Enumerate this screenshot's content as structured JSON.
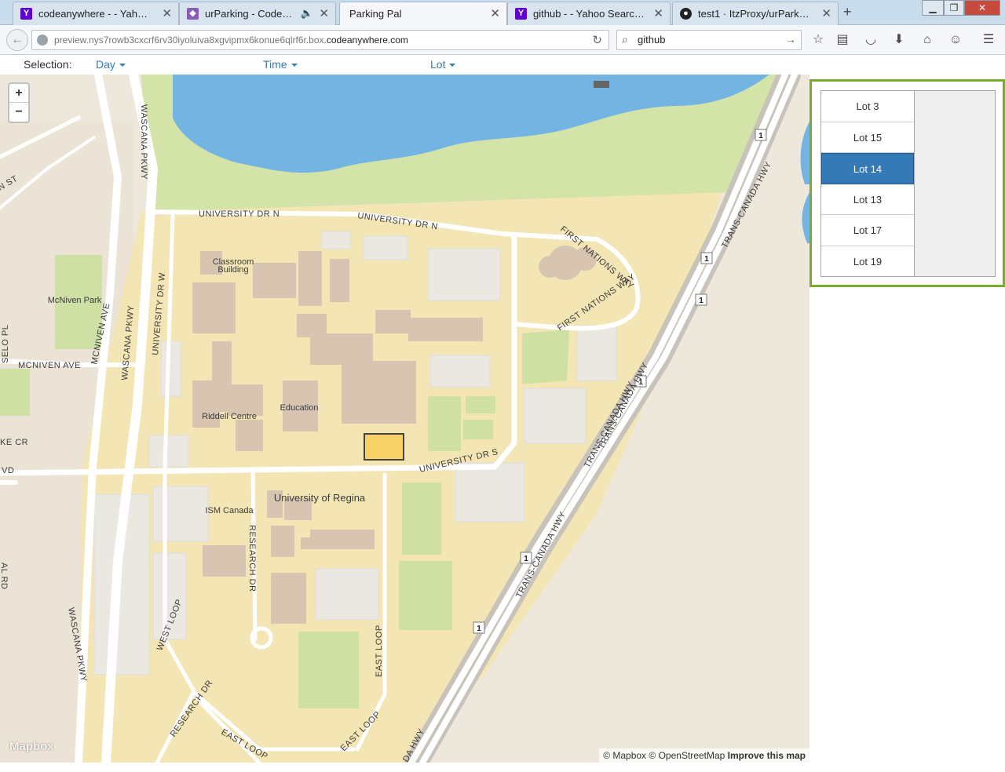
{
  "browser": {
    "tabs": [
      {
        "title": "codeanywhere - - Yahoo S...",
        "icon": "yahoo-icon",
        "active": false
      },
      {
        "title": "urParking - Codeanyw...",
        "icon": "codeanywhere-icon",
        "active": false,
        "audio": true
      },
      {
        "title": "Parking Pal",
        "icon": "none",
        "active": true
      },
      {
        "title": "github - - Yahoo Search Re...",
        "icon": "yahoo-icon",
        "active": false
      },
      {
        "title": "test1 · ItzProxy/urPark@a8f...",
        "icon": "github-icon",
        "active": false
      }
    ],
    "url_prefix": "preview.nys7rowb3cxcrf6rv30iyoluiva8xgvipmx6konue6qlrf6r.box.",
    "url_domain": "codeanywhere.com",
    "search_value": "github"
  },
  "selection": {
    "label": "Selection:",
    "day_label": "Day",
    "time_label": "Time",
    "lot_label": "Lot"
  },
  "map": {
    "zoom_in": "+",
    "zoom_out": "−",
    "logo": "Mapbox",
    "attribution_mapbox": "© Mapbox",
    "attribution_osm": "© OpenStreetMap",
    "attribution_improve": "Improve this map",
    "labels": {
      "university_dr_n_1": "UNIVERSITY DR N",
      "university_dr_n_2": "UNIVERSITY DR N",
      "first_nations_way_1": "FIRST NATIONS WAY",
      "first_nations_way_2": "FIRST NATIONS WAY",
      "classroom_building": "Classroom",
      "classroom_building_2": "Building",
      "mcniven_park": "McNiven Park",
      "mcniven_ave": "MCNIVEN AVE",
      "mcniven_ave_v": "MCNIVEN AVE",
      "wascana_pkwy_1": "WASCANA PKWY",
      "wascana_pkwy_2": "WASCANA PKWY",
      "wascana_pkwy_3": "WASCANA PKWY",
      "university_dr_w": "UNIVERSITY DR W",
      "riddell_centre": "Riddell Centre",
      "education": "Education",
      "university_dr_s": "UNIVERSITY DR S",
      "university_of_regina": "University of Regina",
      "ism_canada": "ISM Canada",
      "research_dr_1": "RESEARCH DR",
      "research_dr_2": "RESEARCH DR",
      "west_loop": "WEST LOOP",
      "east_loop_1": "EAST LOOP",
      "east_loop_2": "EAST LOOP",
      "east_loop_3": "EAST LOOP",
      "trans_canada_1": "TRANS-CANADA HWY",
      "trans_canada_2": "TRANS-CANADA HWY",
      "trans_canada_3": "TRANS-CANADA HWY",
      "trans_canada_4": "TRANS-CANADA HWY",
      "trans_canada_5": "DA HWY",
      "hwy1_a": "1",
      "hwy1_b": "1",
      "hwy1_c": "1",
      "hwy1_d": "1",
      "hwy1_e": "1",
      "hwy1_f": "1",
      "n_st": "N ST",
      "selo_pl": "SELO PL",
      "ke_cr": "KE CR",
      "vd": "VD",
      "al_rd": "AL RD"
    }
  },
  "lots": [
    "Lot 3",
    "Lot 15",
    "Lot 14",
    "Lot 13",
    "Lot 17",
    "Lot 19"
  ],
  "selected_lot": "Lot 14",
  "colors": {
    "panel_border": "#7bab2f",
    "selected_lot_bg": "#337ab7",
    "lake": "#74b4e3",
    "park_green": "#cfe0a4",
    "campus": "#f2e4b0",
    "highlight_lot": "#f7d067"
  }
}
